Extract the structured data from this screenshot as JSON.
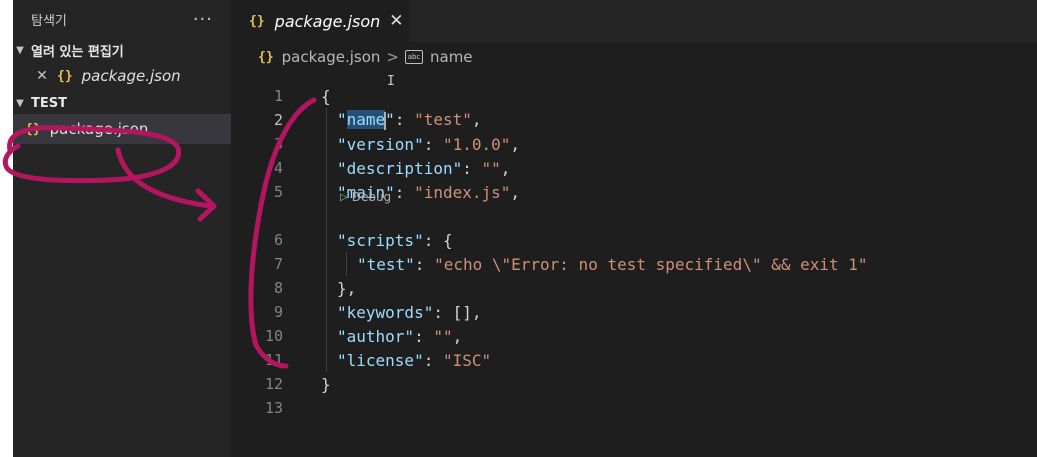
{
  "explorer": {
    "title": "탐색기",
    "more_label": "···",
    "open_editors": {
      "label": "열려 있는 편집기",
      "items": [
        {
          "icon": "{}",
          "name": "package.json"
        }
      ]
    },
    "folder": {
      "label": "TEST",
      "items": [
        {
          "icon": "{}",
          "name": "package.json"
        }
      ]
    }
  },
  "tabs": [
    {
      "icon": "{}",
      "label": "package.json"
    }
  ],
  "breadcrumb": {
    "file": "package.json",
    "sep": ">",
    "symbol_icon": "abc",
    "symbol": "name"
  },
  "codelens": {
    "label": "Debug"
  },
  "code": {
    "lines": [
      {
        "n": "1",
        "current": false
      },
      {
        "n": "2",
        "current": true
      },
      {
        "n": "3",
        "current": false
      },
      {
        "n": "4",
        "current": false
      },
      {
        "n": "5",
        "current": false
      },
      {
        "n": "6",
        "current": false
      },
      {
        "n": "7",
        "current": false
      },
      {
        "n": "8",
        "current": false
      },
      {
        "n": "9",
        "current": false
      },
      {
        "n": "10",
        "current": false
      },
      {
        "n": "11",
        "current": false
      },
      {
        "n": "12",
        "current": false
      },
      {
        "n": "13",
        "current": false
      }
    ],
    "tokens": {
      "l1": "{",
      "l2_key": "name",
      "l2_val": "\"test\"",
      "l3_key": "\"version\"",
      "l3_val": "\"1.0.0\"",
      "l4_key": "\"description\"",
      "l4_val": "\"\"",
      "l5_key": "\"main\"",
      "l5_val": "\"index.js\"",
      "l6_key": "\"scripts\"",
      "l6_rest": ": {",
      "l7_key": "\"test\"",
      "l7_val": "\"echo \\\"Error: no test specified\\\" && exit 1\"",
      "l8": "},",
      "l9_key": "\"keywords\"",
      "l9_rest": ": [],",
      "l10_key": "\"author\"",
      "l10_val": "\"\"",
      "l11_key": "\"license\"",
      "l11_val": "\"ISC\"",
      "l12": "}"
    }
  },
  "colors": {
    "annotation": "#b3155f",
    "json_icon": "#e8c349",
    "key": "#9cdcfe",
    "string": "#ce9178"
  }
}
